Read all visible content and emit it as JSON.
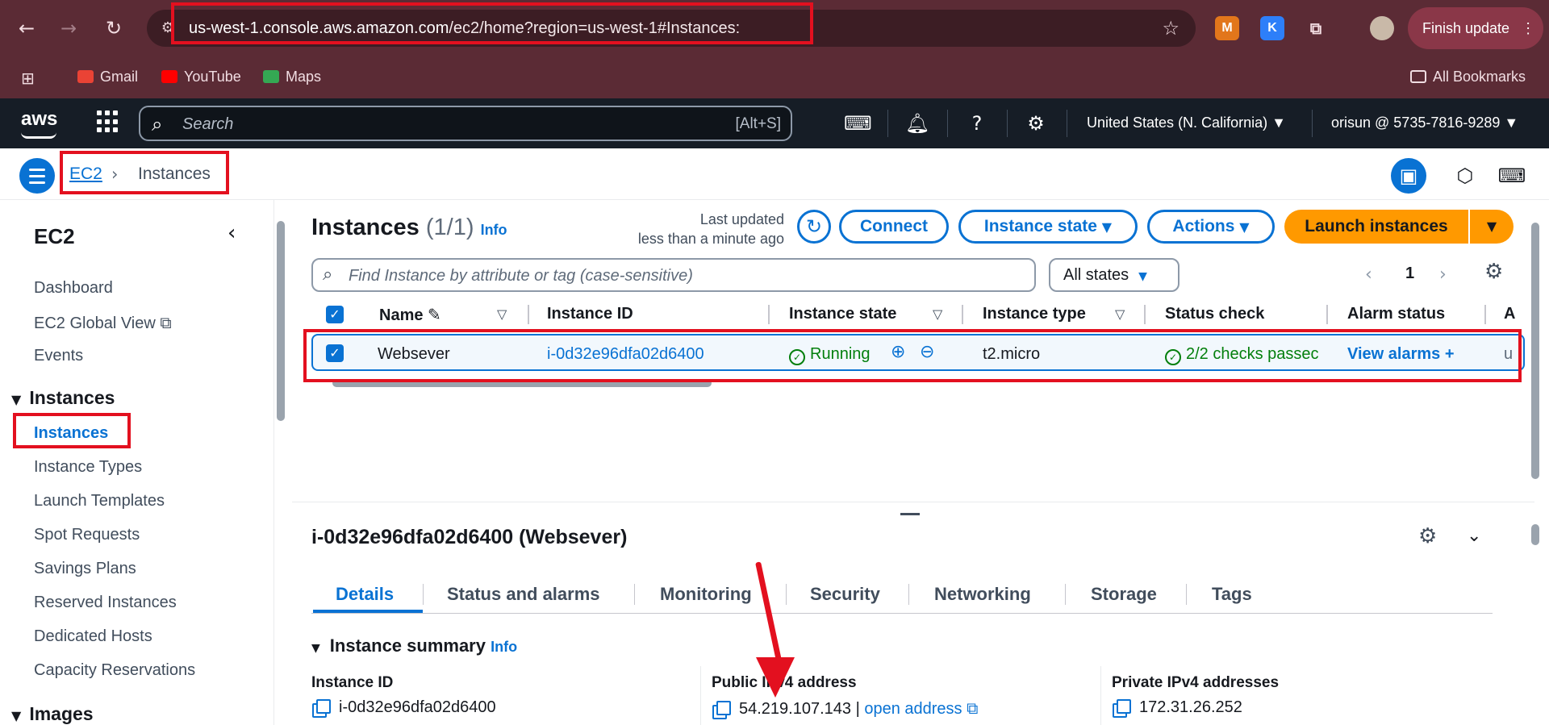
{
  "browser": {
    "url_host": "us-west-1.console.aws.amazon.com",
    "url_path": "/ec2/home?region=us-west-1#Instances:",
    "finish_update": "Finish update",
    "bookmarks": [
      "Gmail",
      "YouTube",
      "Maps"
    ],
    "all_bookmarks": "All Bookmarks"
  },
  "aws": {
    "logo": "aws",
    "search_placeholder": "Search",
    "search_hint": "[Alt+S]",
    "region": "United States (N. California) ▼",
    "account": "orisun @ 5735-7816-9289 ▼"
  },
  "breadcrumb": {
    "root": "EC2",
    "current": "Instances"
  },
  "sidebar": {
    "title": "EC2",
    "items_top": [
      "Dashboard",
      "EC2 Global View",
      "Events"
    ],
    "instances_section": "Instances",
    "instances_items": [
      "Instances",
      "Instance Types",
      "Launch Templates",
      "Spot Requests",
      "Savings Plans",
      "Reserved Instances",
      "Dedicated Hosts",
      "Capacity Reservations"
    ],
    "images_section": "Images"
  },
  "instances_panel": {
    "title": "Instances",
    "count": "(1/1)",
    "info": "Info",
    "last_updated_1": "Last updated",
    "last_updated_2": "less than a minute ago",
    "connect": "Connect",
    "instance_state": "Instance state",
    "actions": "Actions",
    "launch": "Launch instances",
    "filter_placeholder": "Find Instance by attribute or tag (case-sensitive)",
    "states_filter": "All states",
    "page": "1",
    "columns": [
      "Name",
      "Instance ID",
      "Instance state",
      "Instance type",
      "Status check",
      "Alarm status",
      "A"
    ],
    "row": {
      "name": "Websever",
      "instance_id": "i-0d32e96dfa02d6400",
      "state": "Running",
      "type": "t2.micro",
      "status_check": "2/2 checks passec",
      "alarm": "View alarms +",
      "extra": "u"
    }
  },
  "details": {
    "title": "i-0d32e96dfa02d6400 (Websever)",
    "tabs": [
      "Details",
      "Status and alarms",
      "Monitoring",
      "Security",
      "Networking",
      "Storage",
      "Tags"
    ],
    "summary": "Instance summary",
    "summary_info": "Info",
    "instance_id_label": "Instance ID",
    "instance_id_value": "i-0d32e96dfa02d6400",
    "public_ipv4_label": "Public IPv4 address",
    "public_ipv4_value": "54.219.107.143",
    "open_address": "open address",
    "private_ipv4_label": "Private IPv4 addresses",
    "private_ipv4_value": "172.31.26.252"
  },
  "colors": {
    "accent": "#0972d3",
    "launch": "#ff9900",
    "annotation": "#e3101f",
    "running": "#037f0c"
  }
}
